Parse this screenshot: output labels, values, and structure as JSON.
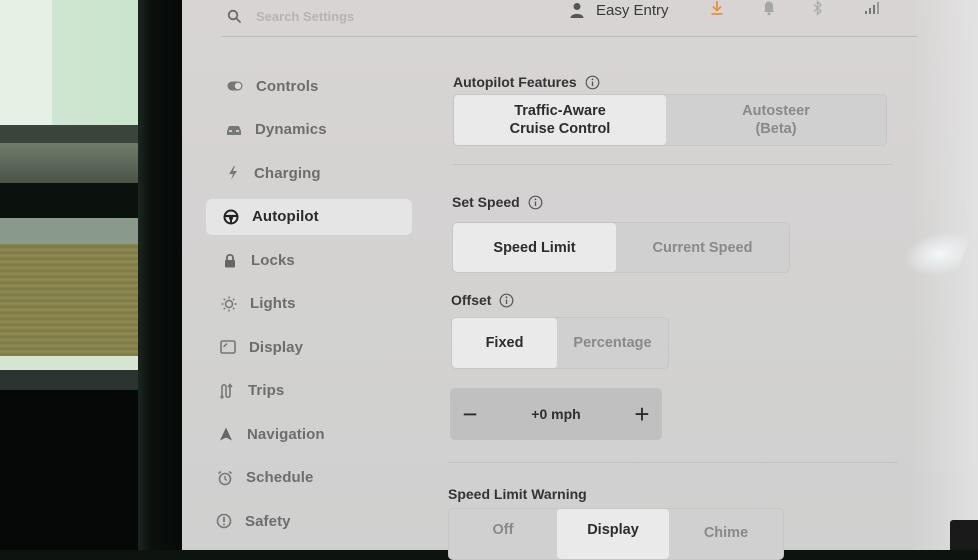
{
  "topbar": {
    "search_placeholder": "Search Settings",
    "profile_name": "Easy Entry",
    "icons": [
      "search-icon",
      "person-icon",
      "download-icon",
      "bell-icon",
      "bluetooth-icon",
      "lte-signal-icon"
    ],
    "download_color": "#e8913a"
  },
  "sidebar": {
    "items": [
      {
        "label": "Controls",
        "icon": "toggle-icon",
        "active": false
      },
      {
        "label": "Dynamics",
        "icon": "car-icon",
        "active": false
      },
      {
        "label": "Charging",
        "icon": "lightning-icon",
        "active": false
      },
      {
        "label": "Autopilot",
        "icon": "steering-wheel-icon",
        "active": true
      },
      {
        "label": "Locks",
        "icon": "lock-icon",
        "active": false
      },
      {
        "label": "Lights",
        "icon": "sun-icon",
        "active": false
      },
      {
        "label": "Display",
        "icon": "display-icon",
        "active": false
      },
      {
        "label": "Trips",
        "icon": "trips-icon",
        "active": false
      },
      {
        "label": "Navigation",
        "icon": "navigation-arrow-icon",
        "active": false
      },
      {
        "label": "Schedule",
        "icon": "alarm-clock-icon",
        "active": false
      },
      {
        "label": "Safety",
        "icon": "alert-circle-icon",
        "active": false
      }
    ]
  },
  "main": {
    "autopilot_features": {
      "title": "Autopilot Features",
      "options": [
        {
          "label": "Traffic-Aware\nCruise Control",
          "selected": true
        },
        {
          "label": "Autosteer\n(Beta)",
          "selected": false
        }
      ]
    },
    "set_speed": {
      "title": "Set Speed",
      "options": [
        {
          "label": "Speed Limit",
          "selected": true
        },
        {
          "label": "Current Speed",
          "selected": false
        }
      ]
    },
    "offset": {
      "title": "Offset",
      "options": [
        {
          "label": "Fixed",
          "selected": true
        },
        {
          "label": "Percentage",
          "selected": false
        }
      ],
      "stepper": {
        "minus": "−",
        "value": "+0 mph",
        "plus": "+"
      }
    },
    "speed_limit_warning": {
      "title": "Speed Limit Warning",
      "options": [
        {
          "label": "Off",
          "selected": false
        },
        {
          "label": "Display",
          "selected": true
        },
        {
          "label": "Chime",
          "selected": false
        }
      ]
    }
  }
}
